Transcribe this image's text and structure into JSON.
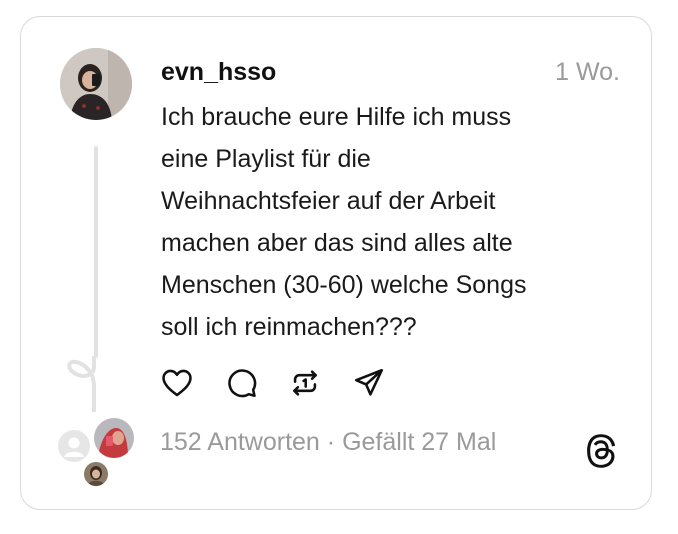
{
  "post": {
    "username": "evn_hsso",
    "time": "1 Wo.",
    "text": "Ich brauche eure Hilfe ich muss\neine Playlist für die\nWeihnachtsfeier auf der Arbeit\nmachen aber das sind alles alte\nMenschen (30-60) welche Songs\nsoll ich reinmachen???",
    "replies": "152 Antworten",
    "separator": " · ",
    "likes": "Gefällt 27 Mal"
  },
  "icons": {
    "like": "heart-icon",
    "reply": "comment-icon",
    "repost": "repost-icon",
    "share": "send-icon",
    "brand": "threads-logo-icon"
  },
  "colors": {
    "text": "#1a1a1a",
    "muted": "#9a9a9a",
    "border": "#d9d9d9",
    "thread_line": "#e2e2e2"
  }
}
